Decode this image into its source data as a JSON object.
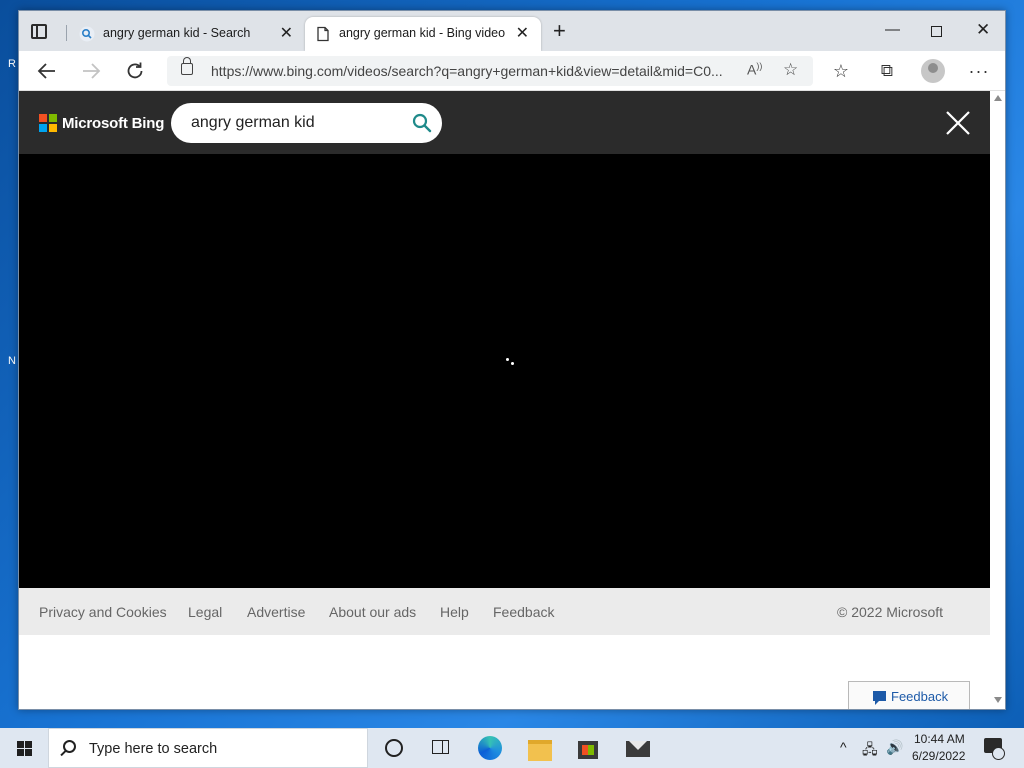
{
  "browser": {
    "tabs": [
      {
        "title": "angry german kid - Search",
        "active": false,
        "favicon": "search-icon"
      },
      {
        "title": "angry german kid - Bing video",
        "active": true,
        "favicon": "page-icon"
      }
    ],
    "url": "https://www.bing.com/videos/search?q=angry+german+kid&view=detail&mid=C0..."
  },
  "bing": {
    "brand": "Microsoft Bing",
    "search_value": "angry german kid"
  },
  "footer": {
    "links": [
      "Privacy and Cookies",
      "Legal",
      "Advertise",
      "About our ads",
      "Help",
      "Feedback"
    ],
    "copyright": "© 2022 Microsoft"
  },
  "feedback_button": "Feedback",
  "taskbar": {
    "search_placeholder": "Type here to search",
    "time": "10:44 AM",
    "date": "6/29/2022"
  },
  "colors": {
    "header_bg": "#2b2b2b",
    "video_bg": "#000000",
    "footer_bg": "#ebebeb",
    "search_icon": "#1f8a8a"
  }
}
